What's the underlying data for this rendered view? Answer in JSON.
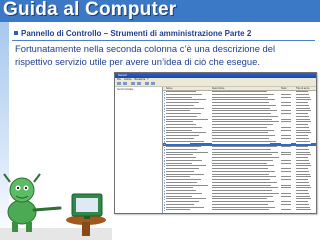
{
  "slide": {
    "title": "Guida al Computer",
    "subtitle": "Pannello di Controllo – Strumenti di amministrazione Parte 2",
    "description": "Fortunatamente nella seconda colonna c’è una descrizione del rispettivo servizio utile per avere un’idea di ciò che esegue."
  },
  "colors": {
    "header": "#3b78c6",
    "title_text": "#ffffff",
    "body_text": "#1f3f8f",
    "window_title": "#1a48a8"
  },
  "window": {
    "title": "Servizi",
    "menu": [
      "File",
      "Azione",
      "Visualizza",
      "?"
    ],
    "tree_label": "Servizi (locale)",
    "columns": [
      "Nome",
      "Descrizione",
      "Stato",
      "Tipo di avvio"
    ],
    "icons": [
      "minimize-icon",
      "maximize-icon",
      "close-icon",
      "service-icon",
      "folder-icon",
      "toolbar-icon"
    ]
  }
}
